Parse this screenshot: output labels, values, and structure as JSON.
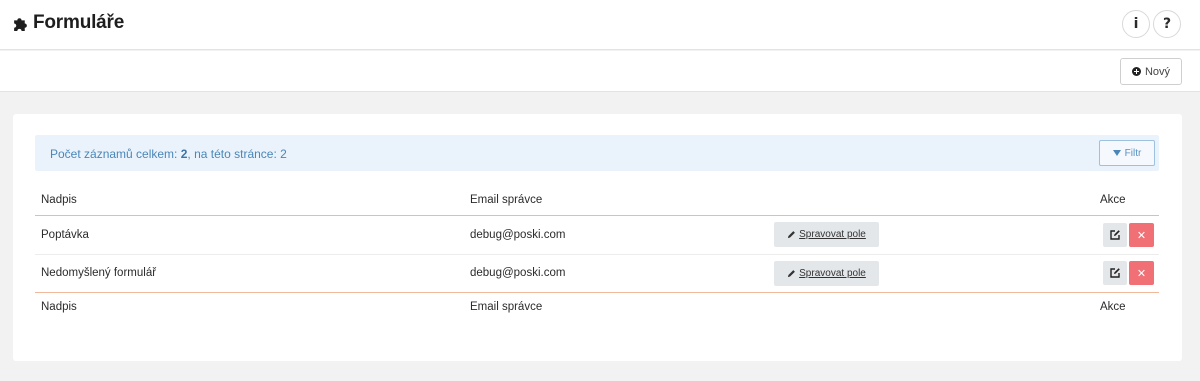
{
  "header": {
    "title": "Formuláře",
    "info_label": "i",
    "help_label": "?"
  },
  "toolbar": {
    "new_label": "Nový"
  },
  "summary": {
    "prefix": "Počet záznamů celkem: ",
    "total": "2",
    "middle": ", na této stránce: ",
    "on_page": "2"
  },
  "filter": {
    "label": "Filtr"
  },
  "table": {
    "columns": [
      "Nadpis",
      "Email správce",
      "Akce"
    ],
    "rows": [
      {
        "title": "Poptávka",
        "email": "debug@poski.com",
        "manage_label": "Spravovat pole"
      },
      {
        "title": "Nedomyšlený formulář",
        "email": "debug@poski.com",
        "manage_label": "Spravovat pole"
      }
    ],
    "footer_columns": [
      "Nadpis",
      "Email správce",
      "Akce"
    ]
  },
  "icons": {
    "title": "puzzle-icon",
    "new": "plus-circle-icon",
    "filter": "filter-icon",
    "manage": "pencil-icon",
    "edit": "edit-icon",
    "delete": "close-icon"
  },
  "colors": {
    "accent_line": "#f0b99c",
    "info_bg": "#eaf3fb",
    "info_text": "#4a86b8",
    "delete": "#f07076"
  }
}
